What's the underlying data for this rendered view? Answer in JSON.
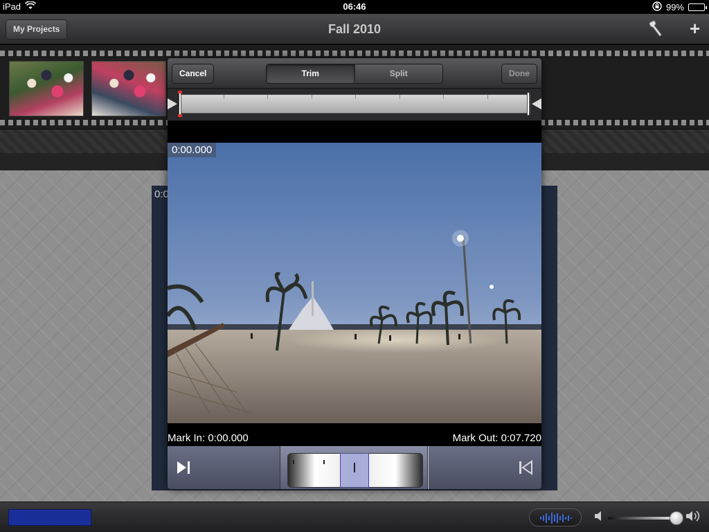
{
  "status": {
    "device": "iPad",
    "time": "06:46",
    "battery": "99%",
    "battery_level": 0.99
  },
  "nav": {
    "back_label": "My Projects",
    "title": "Fall 2010",
    "settings_icon": "wrench-icon",
    "add_label": "+"
  },
  "viewer_bg": {
    "timecode": "0:0"
  },
  "dialog": {
    "cancel_label": "Cancel",
    "done_label": "Done",
    "segments": [
      "Trim",
      "Split"
    ],
    "active_segment": "Trim",
    "timecode": "0:00.000",
    "mark_in": "Mark In: 0:00.000",
    "mark_out": "Mark Out: 0:07.720"
  },
  "bottom": {
    "volume_level": 0.92
  },
  "colors": {
    "progress": "#1a2f9a",
    "trim_marker": "#e03030",
    "transport": "#5a5e78"
  }
}
